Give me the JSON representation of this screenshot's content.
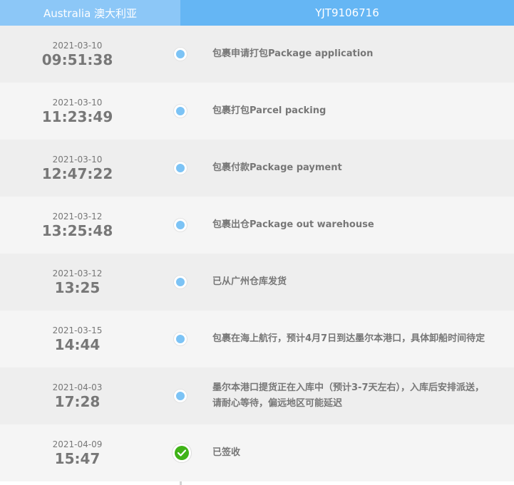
{
  "header": {
    "country": "Australia 澳大利亚",
    "tracking_number": "YJT9106716"
  },
  "events": [
    {
      "date": "2021-03-10",
      "time": "09:51:38",
      "description": "包裹申请打包Package application",
      "status": "dot"
    },
    {
      "date": "2021-03-10",
      "time": "11:23:49",
      "description": "包裹打包Parcel packing",
      "status": "dot"
    },
    {
      "date": "2021-03-10",
      "time": "12:47:22",
      "description": "包裹付款Package payment",
      "status": "dot"
    },
    {
      "date": "2021-03-12",
      "time": "13:25:48",
      "description": "包裹出仓Package out warehouse",
      "status": "dot"
    },
    {
      "date": "2021-03-12",
      "time": "13:25",
      "description": "已从广州仓库发货",
      "status": "dot"
    },
    {
      "date": "2021-03-15",
      "time": "14:44",
      "description": "包裹在海上航行，预计4月7日到达墨尔本港口，具体卸船时间待定",
      "status": "dot"
    },
    {
      "date": "2021-04-03",
      "time": "17:28",
      "description": "墨尔本港口提货正在入库中（预计3-7天左右），入库后安排派送，请耐心等待，偏远地区可能延迟",
      "status": "dot"
    },
    {
      "date": "2021-04-09",
      "time": "15:47",
      "description": "已签收",
      "status": "delivered-check"
    }
  ],
  "colors": {
    "header_left": "#8cc7f7",
    "header_right": "#65b6f4",
    "dot": "#7cc3f5",
    "delivered": "#3fb317"
  }
}
